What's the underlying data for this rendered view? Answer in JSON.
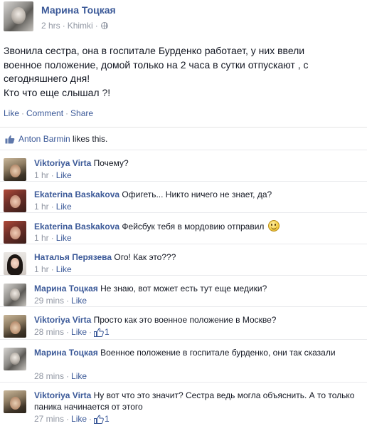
{
  "post": {
    "author": "Марина Тоцкая",
    "time": "2 hrs",
    "location": "Khimki",
    "meta_sep": "·",
    "text_lines": [
      "Звонила сестра, она в госпитале Бурденко работает, у них ввели",
      "военное положение, домой только на 2 часа в сутки отпускают , с",
      "сегодняшнего дня!",
      "Кто что еще слышал ?!"
    ],
    "actions": {
      "like": "Like",
      "comment": "Comment",
      "share": "Share",
      "sep": "·"
    }
  },
  "likes": {
    "liker": "Anton Barmin",
    "suffix": " likes this."
  },
  "comments": [
    {
      "author": "Viktoriya Virta",
      "text": "Почему?",
      "time": "1 hr",
      "like": "Like"
    },
    {
      "author": "Ekaterina Baskakova",
      "text": "Офигеть... Никто ничего не знает, да?",
      "time": "1 hr",
      "like": "Like"
    },
    {
      "author": "Ekaterina Baskakova",
      "text": "Фейсбук тебя в мордовию отправил",
      "time": "1 hr",
      "like": "Like",
      "emoji": "smiley-icon"
    },
    {
      "author": "Наталья Перязева",
      "text": "Ого! Как это???",
      "time": "1 hr",
      "like": "Like"
    },
    {
      "author": "Марина Тоцкая",
      "text": "Не знаю, вот может есть тут еще медики?",
      "time": "29 mins",
      "like": "Like"
    },
    {
      "author": "Viktoriya Virta",
      "text": "Просто как это военное положение в Москве?",
      "time": "28 mins",
      "like": "Like",
      "like_count": "1"
    },
    {
      "author": "Марина Тоцкая",
      "text": "Военное положение в госпитале бурденко, они так сказали",
      "time": "28 mins",
      "like": "Like"
    },
    {
      "author": "Viktoriya Virta",
      "text": "Ну вот что это значит? Сестра ведь могла объяснить. А то только паника начинается от этого",
      "time": "27 mins",
      "like": "Like",
      "like_count": "1"
    }
  ],
  "colors": {
    "link": "#3b5998",
    "meta": "#9197a3",
    "text": "#141823"
  }
}
